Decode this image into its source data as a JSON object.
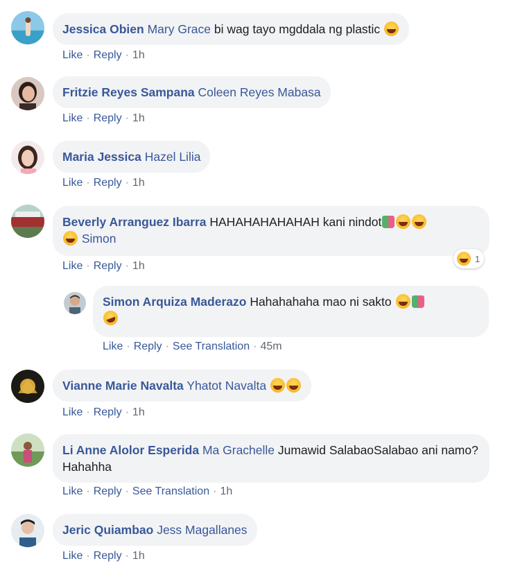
{
  "actions": {
    "like": "Like",
    "reply": "Reply",
    "see_translation": "See Translation",
    "separator": "·"
  },
  "comments": [
    {
      "author": "Jessica Obien",
      "mention": "Mary Grace",
      "text": "bi wag tayo mgddala ng plastic",
      "time": "1h"
    },
    {
      "author": "Fritzie Reyes Sampana",
      "mention": "Coleen Reyes Mabasa",
      "text": "",
      "time": "1h"
    },
    {
      "author": "Maria Jessica",
      "mention": "Hazel Lilia",
      "text": "",
      "time": "1h"
    },
    {
      "author": "Beverly Arranguez Ibarra",
      "text": "HAHAHAHAHAHAH kani nindot",
      "mention": "Simon",
      "time": "1h",
      "reaction_count": "1"
    },
    {
      "author": "Simon Arquiza Maderazo",
      "text": "Hahahahaha mao ni sakto",
      "time": "45m"
    },
    {
      "author": "Vianne Marie Navalta",
      "mention": "Yhatot Navalta",
      "text": "",
      "time": "1h"
    },
    {
      "author": "Li Anne Alolor Esperida",
      "mention": "Ma Grachelle",
      "text": "Jumawid SalabaoSalabao ani namo? Hahahha",
      "time": "1h"
    },
    {
      "author": "Jeric Quiambao",
      "mention": "Jess Magallanes",
      "text": "",
      "time": "1h"
    }
  ]
}
